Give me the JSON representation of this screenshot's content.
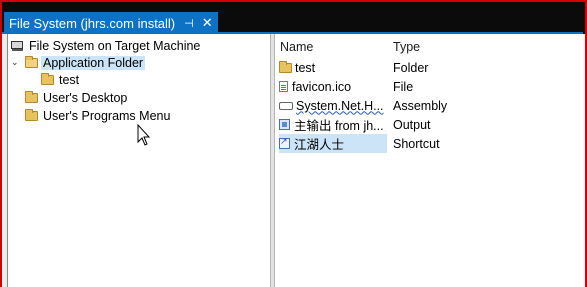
{
  "tab": {
    "title": "File System (jhrs.com install)",
    "pin_glyph": "⊣",
    "close_glyph": "✕"
  },
  "tree": {
    "root": "File System on Target Machine",
    "app_folder": "Application Folder",
    "app_child": "test",
    "users_desktop": "User's Desktop",
    "users_programs": "User's Programs Menu"
  },
  "list": {
    "columns": {
      "name": "Name",
      "type": "Type"
    },
    "rows": [
      {
        "name": "test",
        "type": "Folder"
      },
      {
        "name": "favicon.ico",
        "type": "File"
      },
      {
        "name": "System.Net.H...",
        "type": "Assembly"
      },
      {
        "name": "主输出 from jh...",
        "type": "Output"
      },
      {
        "name": "江湖人士",
        "type": "Shortcut"
      }
    ]
  },
  "colors": {
    "accent": "#0e72c4",
    "selection": "#cce4f7",
    "frame": "#d40000"
  }
}
